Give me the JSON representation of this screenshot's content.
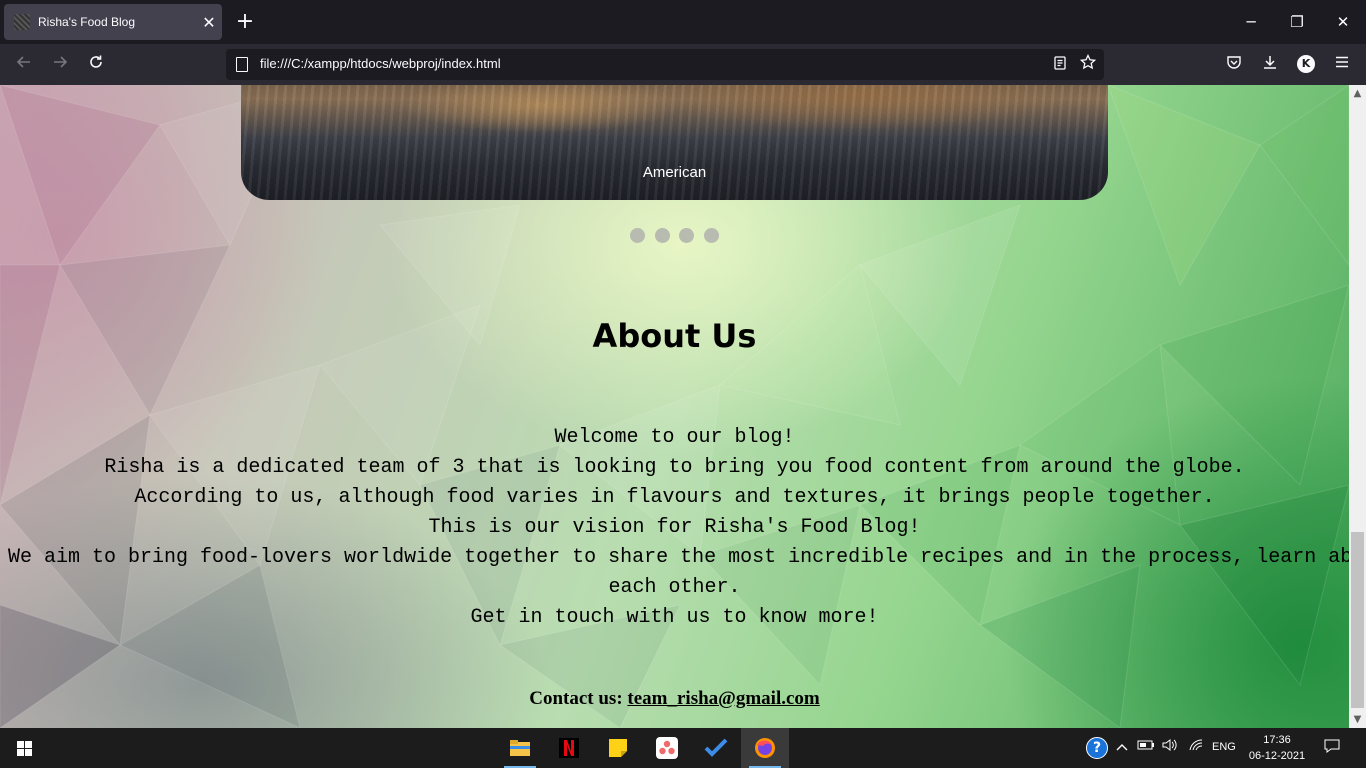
{
  "browser": {
    "tab_title": "Risha's Food Blog",
    "tab_close": "✕",
    "new_tab": "+",
    "url": "file:///C:/xampp/htdocs/webproj/index.html",
    "account_initial": "K",
    "window_controls": {
      "minimize": "─",
      "restore": "❐",
      "close": "✕"
    }
  },
  "page": {
    "carousel": {
      "caption": "American",
      "slide_count": 4
    },
    "about": {
      "title": "About Us",
      "lines": [
        "Welcome to our blog!",
        "Risha is a dedicated team of 3 that is looking to bring you food content from around the globe.",
        "According to us, although food varies in flavours and textures, it brings people together.",
        "This is our vision for Risha's Food Blog!",
        "We aim to bring food-lovers worldwide together to share the most incredible recipes and in the process, learn ab",
        "each other.",
        "Get in touch with us to know more!"
      ]
    },
    "contact": {
      "label": "Contact us:",
      "email": "team_risha@gmail.com"
    }
  },
  "taskbar": {
    "apps": [
      "file-explorer",
      "netflix",
      "sticky-notes",
      "asana",
      "microsoft-todo",
      "firefox"
    ],
    "language": "ENG",
    "time": "17:36",
    "date": "06-12-2021"
  }
}
